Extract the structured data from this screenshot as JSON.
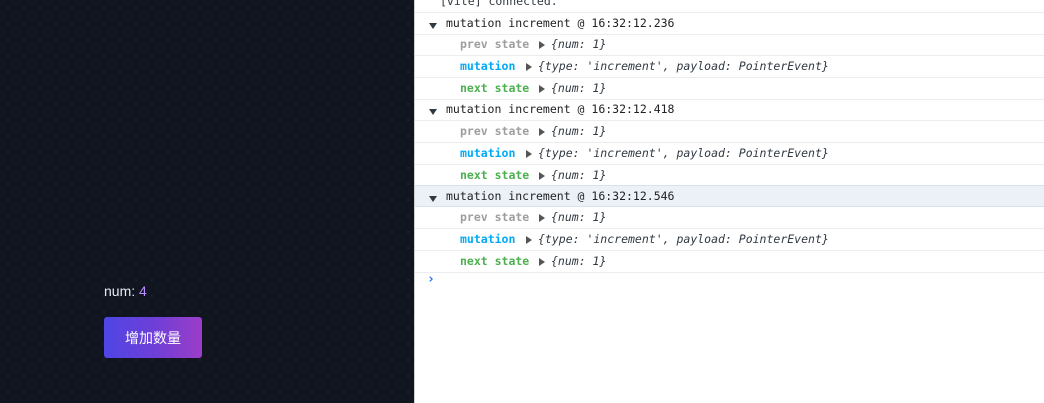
{
  "app": {
    "num_label": "num:",
    "num_value": "4",
    "button_label": "增加数量"
  },
  "console": {
    "vite_message": "[vite] connected.",
    "prev_label": "prev state",
    "mutation_label": "mutation",
    "next_label": "next state",
    "state_obj": "{num: 1}",
    "mutation_obj": "{type: 'increment', payload: PointerEvent}",
    "groups": [
      {
        "title": "mutation increment @ 16:32:12.236"
      },
      {
        "title": "mutation increment @ 16:32:12.418"
      },
      {
        "title": "mutation increment @ 16:32:12.546"
      }
    ],
    "prompt_symbol": "›"
  },
  "colors": {
    "app_bg": "#101520",
    "button_gradient_start": "#4f46e5",
    "button_gradient_end": "#9b3dc8",
    "num_value": "#b98cff",
    "prev_state": "#9e9e9e",
    "mutation": "#03a9f4",
    "next_state": "#4caf50"
  }
}
